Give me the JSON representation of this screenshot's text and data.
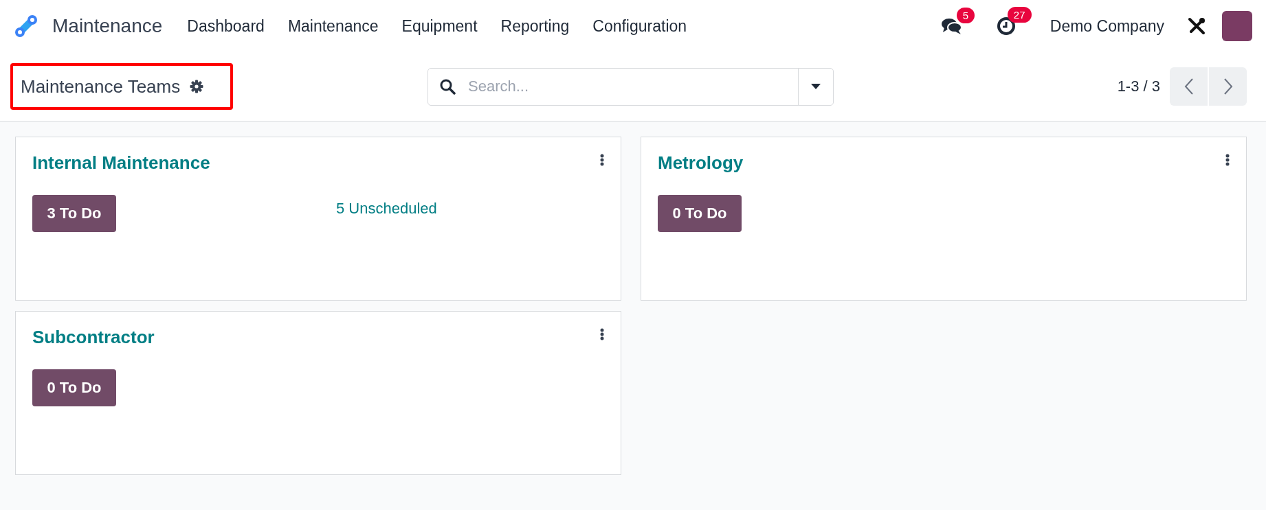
{
  "navbar": {
    "app_name": "Maintenance",
    "menu": [
      "Dashboard",
      "Maintenance",
      "Equipment",
      "Reporting",
      "Configuration"
    ],
    "messages_badge": "5",
    "activities_badge": "27",
    "company": "Demo Company"
  },
  "control_panel": {
    "breadcrumb": "Maintenance Teams",
    "highlighted": true,
    "search": {
      "placeholder": "Search..."
    },
    "pager": "1-3 / 3"
  },
  "teams": [
    {
      "name": "Internal Maintenance",
      "todo": "3 To Do",
      "unscheduled": "5 Unscheduled"
    },
    {
      "name": "Metrology",
      "todo": "0 To Do"
    },
    {
      "name": "Subcontractor",
      "todo": "0 To Do"
    }
  ]
}
